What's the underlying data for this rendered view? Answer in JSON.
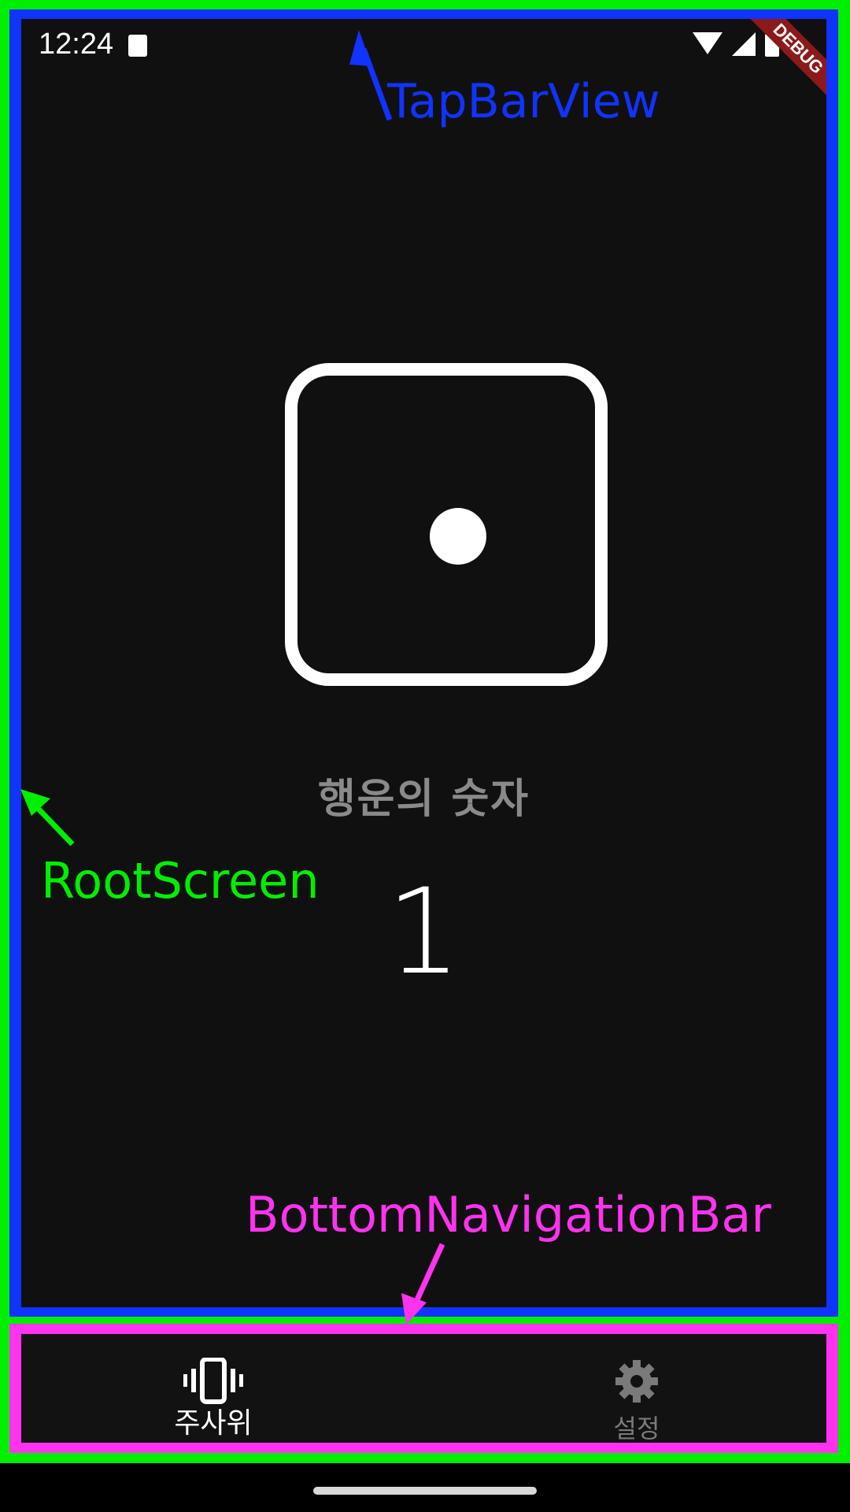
{
  "status_bar": {
    "time": "12:24"
  },
  "debug_banner": "DEBUG",
  "main": {
    "dice_value": 1,
    "lucky_label": "행운의 숫자",
    "lucky_number": "1"
  },
  "annotations": {
    "tab_bar_view": "TapBarView",
    "root_screen": "RootScreen",
    "bottom_navigation_bar": "BottomNavigationBar"
  },
  "bottom_nav": {
    "items": [
      {
        "label": "주사위",
        "icon": "vibrating-phone-icon",
        "active": true
      },
      {
        "label": "설정",
        "icon": "gear-icon",
        "active": false
      }
    ]
  },
  "colors": {
    "root_screen_frame": "#00ee00",
    "tab_bar_view_frame": "#1133ff",
    "bottom_nav_frame": "#ff33ee",
    "background": "#101010",
    "active_label": "#ffffff",
    "inactive_label": "#7a7a7a"
  }
}
